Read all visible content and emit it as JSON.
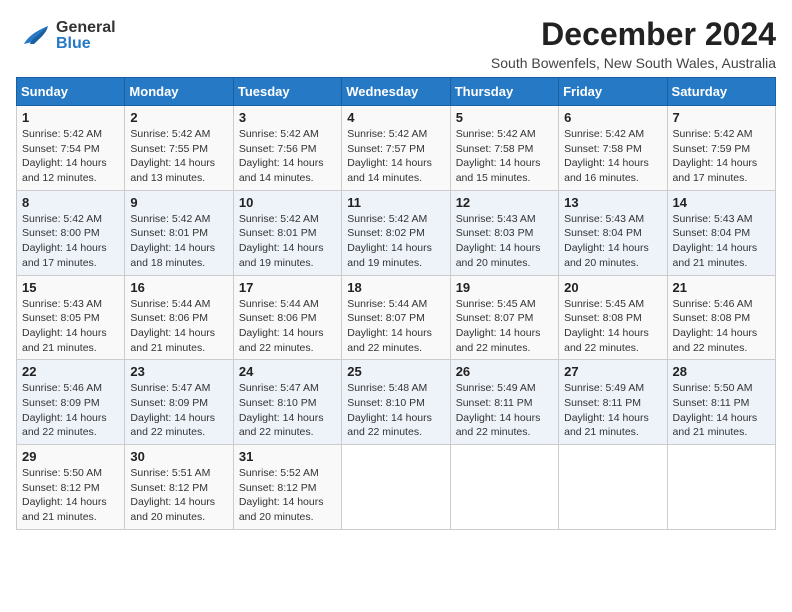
{
  "header": {
    "logo_general": "General",
    "logo_blue": "Blue",
    "title": "December 2024",
    "subtitle": "South Bowenfels, New South Wales, Australia"
  },
  "weekdays": [
    "Sunday",
    "Monday",
    "Tuesday",
    "Wednesday",
    "Thursday",
    "Friday",
    "Saturday"
  ],
  "weeks": [
    [
      {
        "day": "1",
        "info": "Sunrise: 5:42 AM\nSunset: 7:54 PM\nDaylight: 14 hours\nand 12 minutes."
      },
      {
        "day": "2",
        "info": "Sunrise: 5:42 AM\nSunset: 7:55 PM\nDaylight: 14 hours\nand 13 minutes."
      },
      {
        "day": "3",
        "info": "Sunrise: 5:42 AM\nSunset: 7:56 PM\nDaylight: 14 hours\nand 14 minutes."
      },
      {
        "day": "4",
        "info": "Sunrise: 5:42 AM\nSunset: 7:57 PM\nDaylight: 14 hours\nand 14 minutes."
      },
      {
        "day": "5",
        "info": "Sunrise: 5:42 AM\nSunset: 7:58 PM\nDaylight: 14 hours\nand 15 minutes."
      },
      {
        "day": "6",
        "info": "Sunrise: 5:42 AM\nSunset: 7:58 PM\nDaylight: 14 hours\nand 16 minutes."
      },
      {
        "day": "7",
        "info": "Sunrise: 5:42 AM\nSunset: 7:59 PM\nDaylight: 14 hours\nand 17 minutes."
      }
    ],
    [
      {
        "day": "8",
        "info": "Sunrise: 5:42 AM\nSunset: 8:00 PM\nDaylight: 14 hours\nand 17 minutes."
      },
      {
        "day": "9",
        "info": "Sunrise: 5:42 AM\nSunset: 8:01 PM\nDaylight: 14 hours\nand 18 minutes."
      },
      {
        "day": "10",
        "info": "Sunrise: 5:42 AM\nSunset: 8:01 PM\nDaylight: 14 hours\nand 19 minutes."
      },
      {
        "day": "11",
        "info": "Sunrise: 5:42 AM\nSunset: 8:02 PM\nDaylight: 14 hours\nand 19 minutes."
      },
      {
        "day": "12",
        "info": "Sunrise: 5:43 AM\nSunset: 8:03 PM\nDaylight: 14 hours\nand 20 minutes."
      },
      {
        "day": "13",
        "info": "Sunrise: 5:43 AM\nSunset: 8:04 PM\nDaylight: 14 hours\nand 20 minutes."
      },
      {
        "day": "14",
        "info": "Sunrise: 5:43 AM\nSunset: 8:04 PM\nDaylight: 14 hours\nand 21 minutes."
      }
    ],
    [
      {
        "day": "15",
        "info": "Sunrise: 5:43 AM\nSunset: 8:05 PM\nDaylight: 14 hours\nand 21 minutes."
      },
      {
        "day": "16",
        "info": "Sunrise: 5:44 AM\nSunset: 8:06 PM\nDaylight: 14 hours\nand 21 minutes."
      },
      {
        "day": "17",
        "info": "Sunrise: 5:44 AM\nSunset: 8:06 PM\nDaylight: 14 hours\nand 22 minutes."
      },
      {
        "day": "18",
        "info": "Sunrise: 5:44 AM\nSunset: 8:07 PM\nDaylight: 14 hours\nand 22 minutes."
      },
      {
        "day": "19",
        "info": "Sunrise: 5:45 AM\nSunset: 8:07 PM\nDaylight: 14 hours\nand 22 minutes."
      },
      {
        "day": "20",
        "info": "Sunrise: 5:45 AM\nSunset: 8:08 PM\nDaylight: 14 hours\nand 22 minutes."
      },
      {
        "day": "21",
        "info": "Sunrise: 5:46 AM\nSunset: 8:08 PM\nDaylight: 14 hours\nand 22 minutes."
      }
    ],
    [
      {
        "day": "22",
        "info": "Sunrise: 5:46 AM\nSunset: 8:09 PM\nDaylight: 14 hours\nand 22 minutes."
      },
      {
        "day": "23",
        "info": "Sunrise: 5:47 AM\nSunset: 8:09 PM\nDaylight: 14 hours\nand 22 minutes."
      },
      {
        "day": "24",
        "info": "Sunrise: 5:47 AM\nSunset: 8:10 PM\nDaylight: 14 hours\nand 22 minutes."
      },
      {
        "day": "25",
        "info": "Sunrise: 5:48 AM\nSunset: 8:10 PM\nDaylight: 14 hours\nand 22 minutes."
      },
      {
        "day": "26",
        "info": "Sunrise: 5:49 AM\nSunset: 8:11 PM\nDaylight: 14 hours\nand 22 minutes."
      },
      {
        "day": "27",
        "info": "Sunrise: 5:49 AM\nSunset: 8:11 PM\nDaylight: 14 hours\nand 21 minutes."
      },
      {
        "day": "28",
        "info": "Sunrise: 5:50 AM\nSunset: 8:11 PM\nDaylight: 14 hours\nand 21 minutes."
      }
    ],
    [
      {
        "day": "29",
        "info": "Sunrise: 5:50 AM\nSunset: 8:12 PM\nDaylight: 14 hours\nand 21 minutes."
      },
      {
        "day": "30",
        "info": "Sunrise: 5:51 AM\nSunset: 8:12 PM\nDaylight: 14 hours\nand 20 minutes."
      },
      {
        "day": "31",
        "info": "Sunrise: 5:52 AM\nSunset: 8:12 PM\nDaylight: 14 hours\nand 20 minutes."
      },
      {
        "day": "",
        "info": ""
      },
      {
        "day": "",
        "info": ""
      },
      {
        "day": "",
        "info": ""
      },
      {
        "day": "",
        "info": ""
      }
    ]
  ]
}
